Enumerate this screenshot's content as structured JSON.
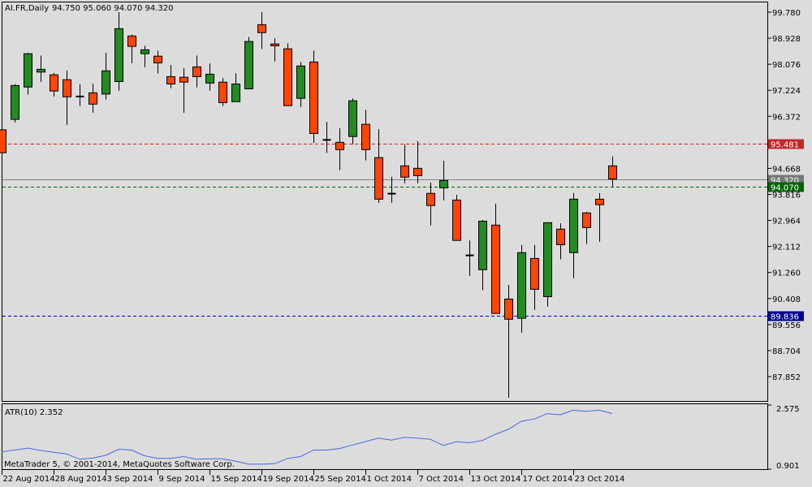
{
  "header": {
    "symbol_timeframe": "AI.FR,Daily",
    "ohlc": "94.750 95.060 94.070 94.320"
  },
  "indicator": {
    "label": "ATR(10) 2.352",
    "scale_max": "2.575",
    "scale_min": "0.901",
    "range": [
      0.901,
      2.575
    ]
  },
  "copyright": "MetaTrader 5, © 2001-2014, MetaQuotes Software Corp.",
  "price_axis": {
    "labels": [
      "99.780",
      "98.928",
      "98.076",
      "97.224",
      "96.372",
      "94.668",
      "93.816",
      "92.964",
      "92.112",
      "91.260",
      "90.408",
      "89.556",
      "88.704",
      "87.852"
    ],
    "range": [
      87.852,
      99.78
    ]
  },
  "levels": [
    {
      "name": "upper-level",
      "value": 95.481,
      "label": "95.481",
      "color": "#c0282c",
      "line": "#d02020"
    },
    {
      "name": "bid-level",
      "value": 94.32,
      "label": "94.320",
      "color": "#777777",
      "line": "#808080"
    },
    {
      "name": "low-level",
      "value": 94.07,
      "label": "94.070",
      "color": "#006400",
      "line": "#006400"
    },
    {
      "name": "lower-level",
      "value": 89.836,
      "label": "89.836",
      "color": "#000090",
      "line": "#0000c0"
    }
  ],
  "colors": {
    "bull": "#228b22",
    "bear": "#ff4500",
    "atr": "#4169e1",
    "background": "#dcdcdc"
  },
  "date_axis": [
    {
      "label": "22 Aug 2014",
      "bar": 0
    },
    {
      "label": "28 Aug 2014",
      "bar": 4
    },
    {
      "label": "3 Sep 2014",
      "bar": 8
    },
    {
      "label": "9 Sep 2014",
      "bar": 12
    },
    {
      "label": "15 Sep 2014",
      "bar": 16
    },
    {
      "label": "19 Sep 2014",
      "bar": 20
    },
    {
      "label": "25 Sep 2014",
      "bar": 24
    },
    {
      "label": "1 Oct 2014",
      "bar": 28
    },
    {
      "label": "7 Oct 2014",
      "bar": 32
    },
    {
      "label": "13 Oct 2014",
      "bar": 36
    },
    {
      "label": "17 Oct 2014",
      "bar": 40
    },
    {
      "label": "23 Oct 2014",
      "bar": 44
    }
  ],
  "chart_data": {
    "type": "candlestick",
    "title": "AI.FR,Daily",
    "fields": [
      "open",
      "high",
      "low",
      "close"
    ],
    "candles": [
      [
        95.93,
        95.98,
        95.13,
        95.18
      ],
      [
        96.27,
        97.43,
        96.17,
        97.38
      ],
      [
        97.33,
        98.45,
        97.08,
        98.42
      ],
      [
        97.82,
        98.36,
        97.5,
        97.91
      ],
      [
        97.73,
        97.79,
        97.02,
        97.2
      ],
      [
        97.57,
        97.87,
        96.09,
        97.01
      ],
      [
        97.02,
        97.42,
        96.71,
        97.02
      ],
      [
        97.14,
        97.44,
        96.49,
        96.77
      ],
      [
        97.1,
        98.45,
        96.92,
        97.86
      ],
      [
        97.51,
        99.78,
        97.21,
        99.24
      ],
      [
        99.0,
        99.05,
        98.11,
        98.66
      ],
      [
        98.42,
        98.68,
        97.98,
        98.55
      ],
      [
        98.34,
        98.52,
        97.77,
        98.12
      ],
      [
        97.67,
        98.05,
        97.29,
        97.43
      ],
      [
        97.65,
        97.95,
        96.49,
        97.49
      ],
      [
        97.99,
        98.36,
        97.32,
        97.67
      ],
      [
        97.46,
        98.1,
        97.21,
        97.75
      ],
      [
        97.49,
        97.62,
        96.71,
        96.82
      ],
      [
        96.85,
        97.78,
        96.85,
        97.43
      ],
      [
        97.27,
        98.97,
        97.27,
        98.82
      ],
      [
        99.37,
        99.78,
        98.57,
        99.11
      ],
      [
        98.74,
        98.93,
        98.17,
        98.68
      ],
      [
        98.58,
        98.76,
        96.72,
        96.72
      ],
      [
        96.96,
        98.15,
        96.68,
        98.02
      ],
      [
        98.15,
        98.52,
        95.5,
        95.81
      ],
      [
        95.6,
        96.19,
        95.17,
        95.6
      ],
      [
        95.52,
        95.98,
        94.61,
        95.28
      ],
      [
        95.71,
        96.96,
        95.46,
        96.88
      ],
      [
        96.11,
        96.59,
        94.93,
        95.28
      ],
      [
        95.02,
        95.95,
        93.54,
        93.66
      ],
      [
        93.84,
        94.39,
        93.54,
        93.84
      ],
      [
        94.75,
        95.45,
        94.18,
        94.38
      ],
      [
        94.67,
        95.56,
        94.18,
        94.43
      ],
      [
        93.85,
        94.2,
        92.8,
        93.45
      ],
      [
        94.03,
        94.92,
        93.62,
        94.27
      ],
      [
        93.63,
        93.8,
        92.31,
        92.31
      ],
      [
        91.82,
        92.31,
        91.15,
        91.82
      ],
      [
        91.35,
        92.98,
        90.68,
        92.94
      ],
      [
        92.81,
        93.51,
        89.92,
        89.92
      ],
      [
        90.39,
        90.85,
        87.16,
        89.73
      ],
      [
        89.76,
        92.16,
        89.29,
        91.91
      ],
      [
        91.72,
        92.16,
        90.04,
        90.71
      ],
      [
        90.47,
        92.89,
        90.14,
        92.89
      ],
      [
        92.68,
        92.87,
        91.69,
        92.17
      ],
      [
        91.91,
        93.86,
        91.07,
        93.66
      ],
      [
        93.21,
        93.24,
        92.19,
        92.73
      ],
      [
        93.66,
        93.86,
        92.27,
        93.48
      ],
      [
        94.75,
        95.06,
        94.07,
        94.32
      ]
    ],
    "atr10": [
      1.35,
      1.4,
      1.45,
      1.39,
      1.34,
      1.3,
      1.16,
      1.19,
      1.26,
      1.42,
      1.4,
      1.25,
      1.18,
      1.18,
      1.23,
      1.16,
      1.17,
      1.17,
      1.11,
      1.03,
      1.03,
      1.04,
      1.18,
      1.23,
      1.4,
      1.4,
      1.44,
      1.53,
      1.62,
      1.71,
      1.66,
      1.73,
      1.71,
      1.68,
      1.52,
      1.62,
      1.59,
      1.65,
      1.81,
      1.94,
      2.15,
      2.21,
      2.35,
      2.32,
      2.44,
      2.41,
      2.44,
      2.352
    ]
  }
}
